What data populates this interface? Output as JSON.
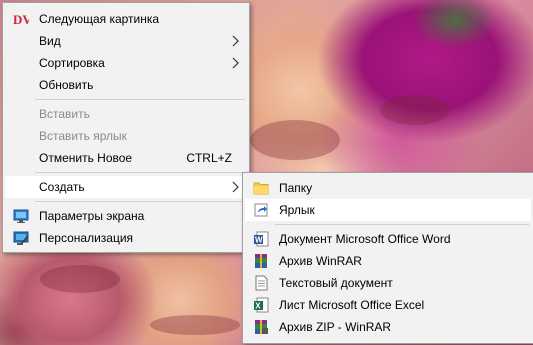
{
  "context_menu": {
    "items": [
      {
        "label": "Следующая картинка",
        "icon": "dv-logo-icon"
      },
      {
        "label": "Вид",
        "submenu": true
      },
      {
        "label": "Сортировка",
        "submenu": true
      },
      {
        "label": "Обновить"
      },
      {
        "label": "Вставить",
        "disabled": true
      },
      {
        "label": "Вставить ярлык",
        "disabled": true
      },
      {
        "label": "Отменить Новое",
        "shortcut": "CTRL+Z"
      },
      {
        "label": "Создать",
        "submenu": true,
        "highlighted": true
      },
      {
        "label": "Параметры экрана",
        "icon": "monitor-icon"
      },
      {
        "label": "Персонализация",
        "icon": "personalize-icon"
      }
    ],
    "dv_logo_text": "DV"
  },
  "create_submenu": {
    "items": [
      {
        "label": "Папку",
        "icon": "folder-icon"
      },
      {
        "label": "Ярлык",
        "icon": "shortcut-icon",
        "highlighted": true
      },
      {
        "label": "Документ Microsoft Office Word",
        "icon": "word-document-icon"
      },
      {
        "label": "Архив WinRAR",
        "icon": "winrar-icon"
      },
      {
        "label": "Текстовый документ",
        "icon": "text-document-icon"
      },
      {
        "label": "Лист Microsoft Office Excel",
        "icon": "excel-sheet-icon"
      },
      {
        "label": "Архив ZIP - WinRAR",
        "icon": "winrar-zip-icon"
      }
    ]
  },
  "colors": {
    "menu_background": "#f2f2f2",
    "highlight": "#ffffff",
    "disabled_text": "#8a8a8a"
  }
}
